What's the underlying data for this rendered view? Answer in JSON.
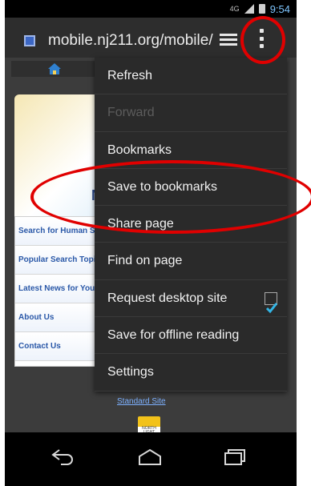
{
  "status": {
    "network": "4G",
    "time": "9:54"
  },
  "browser": {
    "url": "mobile.nj211.org/mobile/"
  },
  "page": {
    "sidebar_links": [
      "Search for Human Services",
      "Popular Search Topics",
      "Latest News for You",
      "About Us",
      "Contact Us"
    ],
    "card_logo": "N",
    "standard_site": "Standard Site",
    "logo_text": "NORTH LIGHT"
  },
  "menu": {
    "items": [
      {
        "label": "Refresh",
        "enabled": true
      },
      {
        "label": "Forward",
        "enabled": false
      },
      {
        "label": "Bookmarks",
        "enabled": true
      },
      {
        "label": "Save to bookmarks",
        "enabled": true
      },
      {
        "label": "Share page",
        "enabled": true
      },
      {
        "label": "Find on page",
        "enabled": true
      },
      {
        "label": "Request desktop site",
        "enabled": true,
        "checked": true
      },
      {
        "label": "Save for offline reading",
        "enabled": true
      },
      {
        "label": "Settings",
        "enabled": true
      }
    ]
  },
  "colors": {
    "annotation": "#e00000",
    "accent": "#33b5e5",
    "link": "#2a58a8"
  }
}
